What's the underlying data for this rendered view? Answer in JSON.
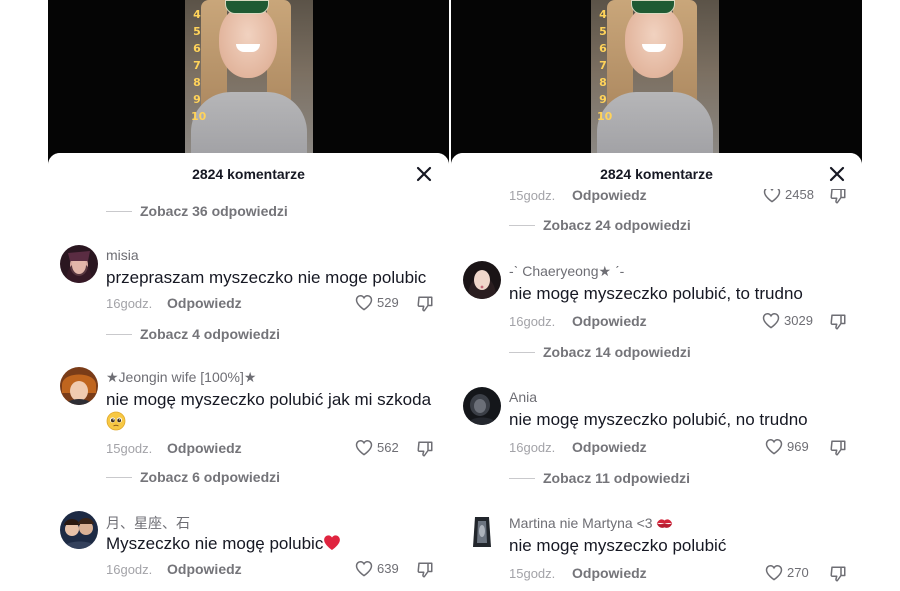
{
  "left": {
    "header": {
      "title": "2824 komentarze"
    },
    "top_view_replies": "Zobacz 36 odpowiedzi",
    "comments": [
      {
        "username": "misia",
        "text": "przepraszam myszeczko nie moge polubic",
        "time": "16godz.",
        "reply": "Odpowiedz",
        "likes": "529",
        "view_replies": "Zobacz 4 odpowiedzi"
      },
      {
        "username": "★Jeongin wife [100%]★",
        "text": "nie mogę myszeczko polubić jak mi szkoda",
        "text_line2_emoji": "pleading-face",
        "time": "15godz.",
        "reply": "Odpowiedz",
        "likes": "562",
        "view_replies": "Zobacz 6 odpowiedzi"
      },
      {
        "username": "月、星座、石",
        "text": "Myszeczko nie mogę polubic",
        "text_emoji": "red-heart",
        "time": "16godz.",
        "reply": "Odpowiedz",
        "likes": "639"
      }
    ]
  },
  "right": {
    "header": {
      "title": "2824 komentarze"
    },
    "partial_row": {
      "time": "15godz.",
      "reply": "Odpowiedz",
      "likes": "2458"
    },
    "top_view_replies": "Zobacz 24 odpowiedzi",
    "comments": [
      {
        "username": "-ˋ Chaeryeong★ ˊ-",
        "text": "nie mogę myszeczko polubić, to trudno",
        "time": "16godz.",
        "reply": "Odpowiedz",
        "likes": "3029",
        "view_replies": "Zobacz 14 odpowiedzi"
      },
      {
        "username": "Ania",
        "text": "nie mogę myszeczko polubić, no trudno",
        "time": "16godz.",
        "reply": "Odpowiedz",
        "likes": "969",
        "view_replies": "Zobacz 11 odpowiedzi"
      },
      {
        "username": "Martina nie Martyna <3",
        "username_emoji": "kiss-mark",
        "text": "nie mogę myszeczko polubić",
        "time": "15godz.",
        "reply": "Odpowiedz",
        "likes": "270"
      }
    ]
  },
  "video_overlay_numbers": [
    "4",
    "5",
    "6",
    "7",
    "8",
    "9",
    "10"
  ],
  "icons": {
    "close": "close-icon",
    "like": "heart-outline-icon",
    "dislike": "thumbs-down-icon"
  },
  "colors": {
    "text": "#161823",
    "muted": "#747479",
    "light": "#a3a3a8",
    "heart": "#e0243f",
    "kiss": "#d2243a"
  }
}
